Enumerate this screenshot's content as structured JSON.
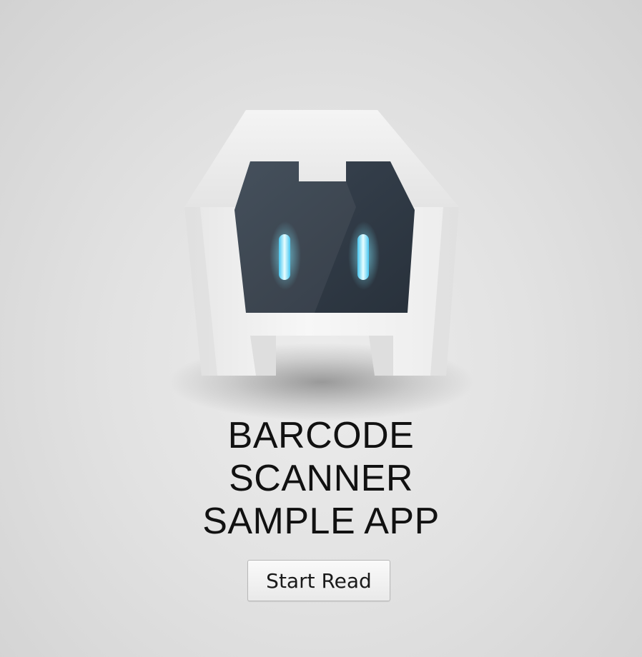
{
  "app": {
    "logo_icon": "cordova-robot-icon",
    "title_lines": [
      "BARCODE",
      "SCANNER",
      "SAMPLE APP"
    ]
  },
  "actions": {
    "start_read_label": "Start Read"
  },
  "colors": {
    "background": "#e2e2e2",
    "logo_body": "#f2f2f2",
    "logo_face": "#323d49",
    "eye_glow": "#7fe8ff",
    "title_text": "#111111"
  }
}
